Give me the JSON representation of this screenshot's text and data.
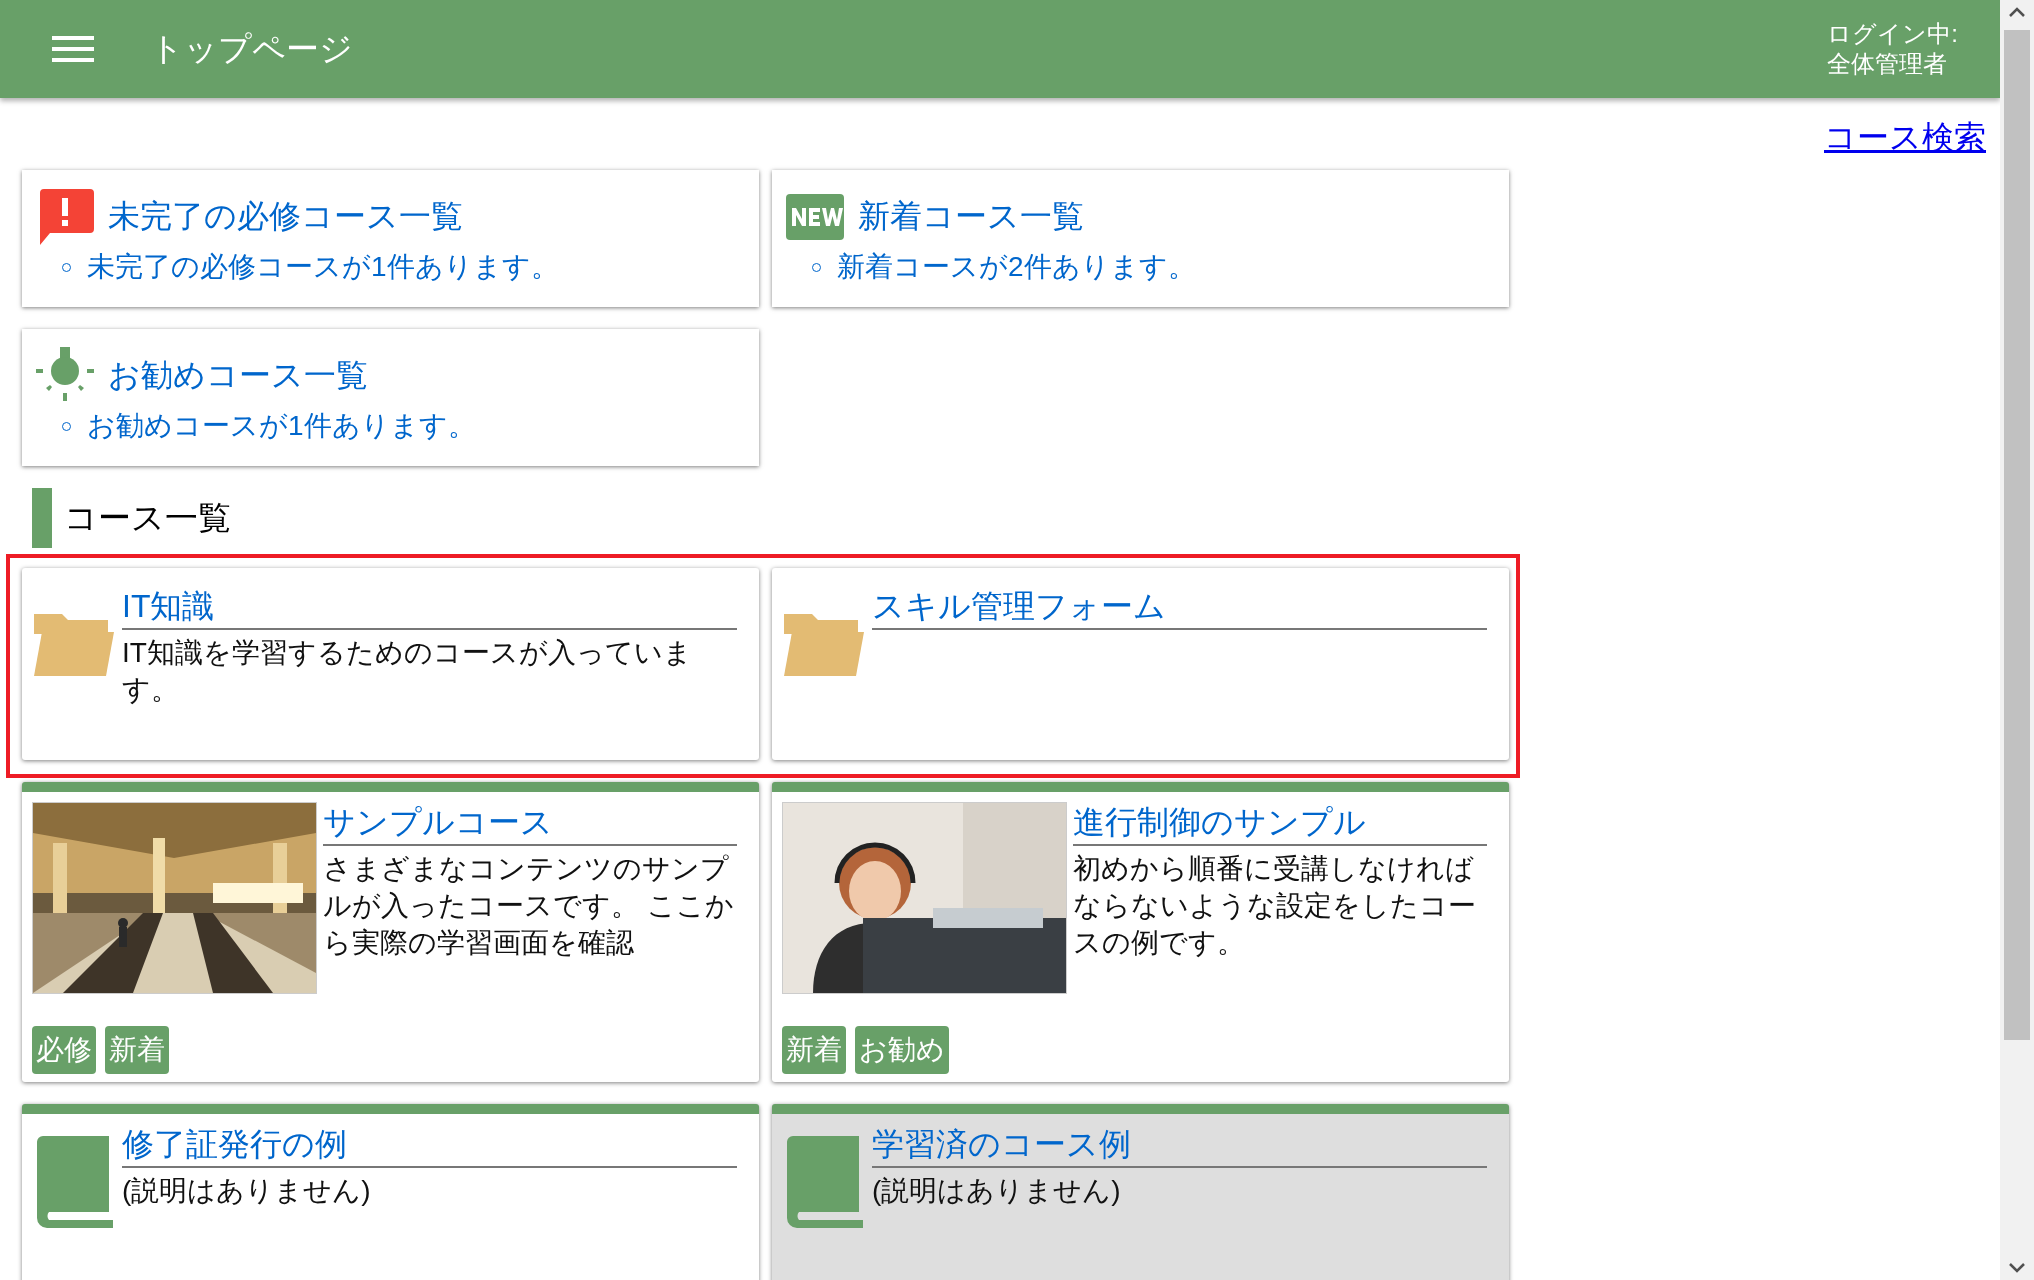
{
  "header": {
    "title": "トップページ",
    "login_label": "ログイン中:",
    "login_user": "全体管理者"
  },
  "search_link": "コース検索",
  "summaries": [
    {
      "kind": "alert",
      "title": "未完了の必修コース一覧",
      "message": "未完了の必修コースが1件あります。"
    },
    {
      "kind": "new",
      "title": "新着コース一覧",
      "message": "新着コースが2件あります。"
    },
    {
      "kind": "recommend",
      "title": "お勧めコース一覧",
      "message": "お勧めコースが1件あります。"
    }
  ],
  "section_title": "コース一覧",
  "course_groups": [
    {
      "highlighted": true,
      "courses": [
        {
          "kind": "folder",
          "title": "IT知識",
          "description": "IT知識を学習するためのコースが入っています。",
          "completed": false
        },
        {
          "kind": "folder",
          "title": "スキル管理フォーム",
          "completed": false
        }
      ]
    },
    {
      "highlighted": false,
      "courses": [
        {
          "kind": "picture",
          "title": "サンプルコース",
          "description": "さまざまなコンテンツのサンプルが入ったコースです。 ここから実際の学習画面を確認",
          "completed": false,
          "tags": [
            "必修",
            "新着"
          ]
        },
        {
          "kind": "picture",
          "title": "進行制御のサンプル",
          "description": "初めから順番に受講しなければならないような設定をしたコースの例です。",
          "completed": false,
          "tags": [
            "新着",
            "お勧め"
          ]
        },
        {
          "kind": "book",
          "title": "修了証発行の例",
          "description": "(説明はありません)",
          "completed": false
        },
        {
          "kind": "book",
          "title": "学習済のコース例",
          "description": "(説明はありません)",
          "completed": true
        }
      ]
    }
  ]
}
